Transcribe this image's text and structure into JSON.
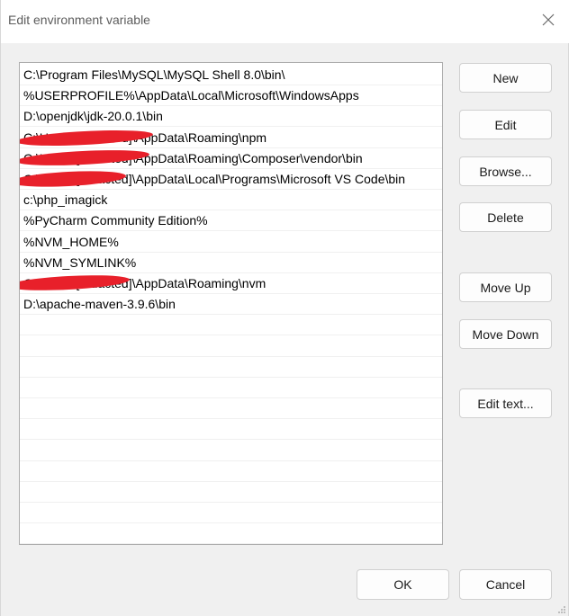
{
  "window": {
    "title": "Edit environment variable",
    "close_glyph": "✕"
  },
  "path_list": {
    "rows": [
      {
        "text": "C:\\Program Files\\MySQL\\MySQL Shell 8.0\\bin\\",
        "redacted": false
      },
      {
        "text": "%USERPROFILE%\\AppData\\Local\\Microsoft\\WindowsApps",
        "redacted": false
      },
      {
        "text": "D:\\openjdk\\jdk-20.0.1\\bin",
        "redacted": false
      },
      {
        "text": "C:\\Users\\[redacted]\\AppData\\Roaming\\npm",
        "redacted": true
      },
      {
        "text": "C:\\Users\\[redacted]\\AppData\\Roaming\\Composer\\vendor\\bin",
        "redacted": true
      },
      {
        "text": "C:\\Users\\[redacted]\\AppData\\Local\\Programs\\Microsoft VS Code\\bin",
        "redacted": true
      },
      {
        "text": "c:\\php_imagick",
        "redacted": false
      },
      {
        "text": "%PyCharm Community Edition%",
        "redacted": false
      },
      {
        "text": "%NVM_HOME%",
        "redacted": false
      },
      {
        "text": "%NVM_SYMLINK%",
        "redacted": false
      },
      {
        "text": "C:\\Users\\[redacted]\\AppData\\Roaming\\nvm",
        "redacted": true
      },
      {
        "text": "D:\\apache-maven-3.9.6\\bin",
        "redacted": false
      },
      {
        "text": "",
        "redacted": false
      },
      {
        "text": "",
        "redacted": false
      },
      {
        "text": "",
        "redacted": false
      },
      {
        "text": "",
        "redacted": false
      },
      {
        "text": "",
        "redacted": false
      },
      {
        "text": "",
        "redacted": false
      },
      {
        "text": "",
        "redacted": false
      },
      {
        "text": "",
        "redacted": false
      },
      {
        "text": "",
        "redacted": false
      },
      {
        "text": "",
        "redacted": false
      },
      {
        "text": "",
        "redacted": false
      }
    ]
  },
  "side_buttons": {
    "new": "New",
    "edit": "Edit",
    "browse": "Browse...",
    "delete": "Delete",
    "move_up": "Move Up",
    "move_down": "Move Down",
    "edit_text": "Edit text..."
  },
  "footer_buttons": {
    "ok": "OK",
    "cancel": "Cancel"
  },
  "colors": {
    "redaction": "#e8202a",
    "dialog_bg": "#f0f0f0",
    "list_bg": "#ffffff"
  }
}
